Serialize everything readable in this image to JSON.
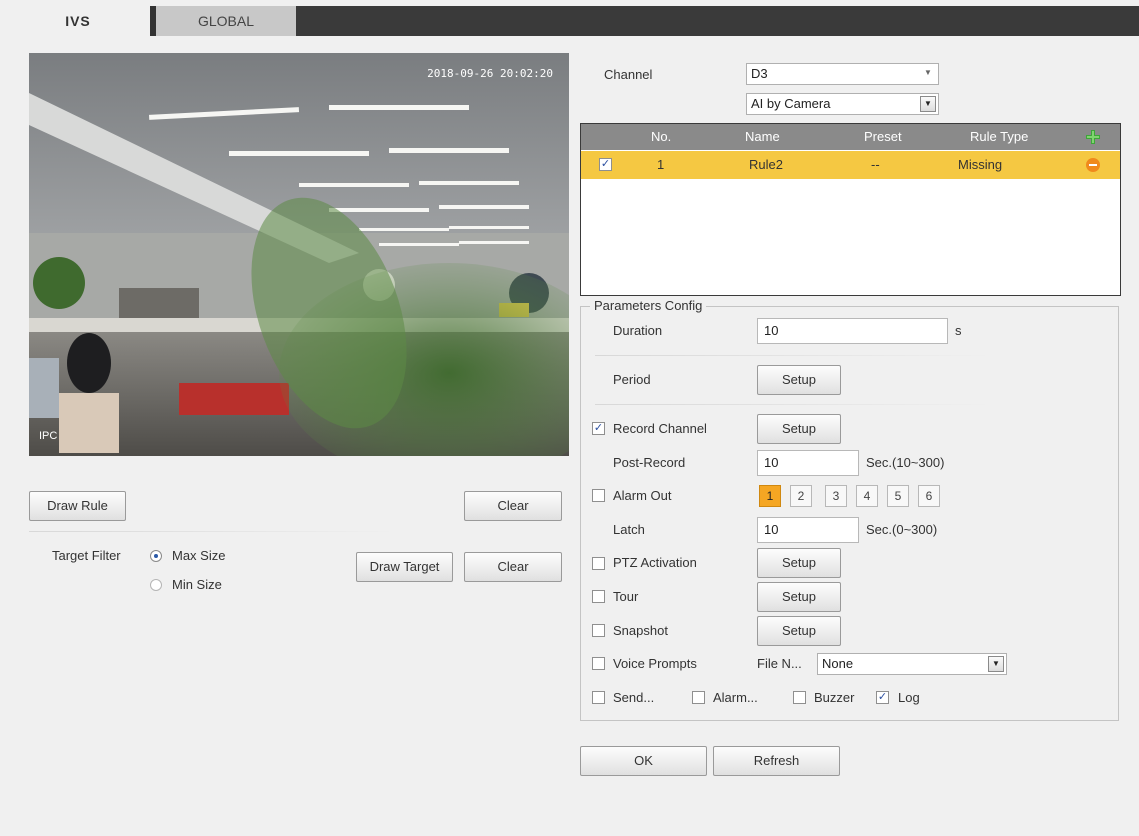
{
  "tabs": [
    {
      "label": "IVS",
      "active": true
    },
    {
      "label": "GLOBAL",
      "active": false
    }
  ],
  "video": {
    "timestamp": "2018-09-26 20:02:20",
    "overlay_label": "IPC"
  },
  "left_controls": {
    "draw_rule": "Draw Rule",
    "clear_rule": "Clear",
    "target_filter_label": "Target Filter",
    "max_size": "Max Size",
    "min_size": "Min Size",
    "draw_target": "Draw Target",
    "clear_target": "Clear",
    "selected_filter": "Max Size"
  },
  "channel": {
    "label": "Channel",
    "value": "D3",
    "mode_value": "AI by Camera"
  },
  "rules_table": {
    "headers": [
      "No.",
      "Name",
      "Preset",
      "Rule Type"
    ],
    "rows": [
      {
        "checked": true,
        "no": "1",
        "name": "Rule2",
        "preset": "--",
        "rule_type": "Missing"
      }
    ],
    "add_icon": "plus-icon",
    "remove_icon": "minus-icon"
  },
  "params": {
    "title": "Parameters Config",
    "duration_label": "Duration",
    "duration_value": "10",
    "duration_unit": "s",
    "period_label": "Period",
    "setup": "Setup",
    "record_channel_label": "Record Channel",
    "record_channel_checked": true,
    "post_record_label": "Post-Record",
    "post_record_value": "10",
    "post_record_range": "Sec.(10~300)",
    "alarm_out_label": "Alarm Out",
    "alarm_out_numbers": [
      "1",
      "2",
      "3",
      "4",
      "5",
      "6"
    ],
    "alarm_out_active": "1",
    "latch_label": "Latch",
    "latch_value": "10",
    "latch_range": "Sec.(0~300)",
    "ptz_label": "PTZ Activation",
    "tour_label": "Tour",
    "snapshot_label": "Snapshot",
    "voice_label": "Voice Prompts",
    "file_label": "File N...",
    "file_value": "None",
    "send_label": "Send...",
    "alarm_label": "Alarm...",
    "buzzer_label": "Buzzer",
    "log_label": "Log",
    "log_checked": true
  },
  "footer": {
    "ok": "OK",
    "refresh": "Refresh"
  },
  "colors": {
    "row_highlight": "#f5c842",
    "header_bg": "#8a8a8a",
    "active_number": "#f5a623",
    "tabbar": "#3a3a3a"
  }
}
